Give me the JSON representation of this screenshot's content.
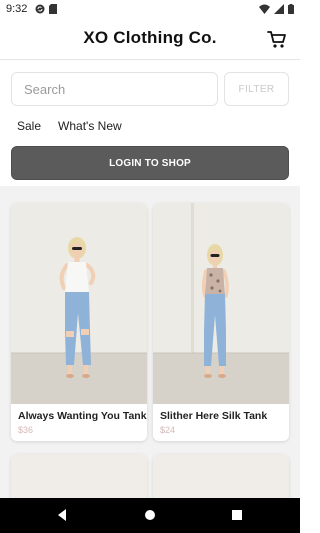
{
  "status_bar": {
    "time": "9:32",
    "left_icons": [
      "sync-icon",
      "sd-card-icon"
    ],
    "right_icons": [
      "wifi-icon",
      "signal-icon",
      "battery-icon"
    ]
  },
  "header": {
    "title": "XO Clothing Co.",
    "cart_icon": "shopping-cart-icon"
  },
  "search": {
    "placeholder": "Search",
    "value": "",
    "filter_label": "FILTER"
  },
  "categories": [
    {
      "label": "Sale"
    },
    {
      "label": "What's New"
    }
  ],
  "login": {
    "label": "LOGIN TO SHOP"
  },
  "products": [
    {
      "name": "Always Wanting You Tank",
      "price": "$36"
    },
    {
      "name": "Slither Here Silk Tank",
      "price": "$24"
    }
  ],
  "navigation": {
    "buttons": [
      "back-icon",
      "home-icon",
      "recents-icon"
    ]
  },
  "colors": {
    "login_button": "#5b5b5b",
    "price_text": "#d7b8b8",
    "filter_text": "#c9c9c9",
    "grid_background": "#f2f2f2"
  }
}
